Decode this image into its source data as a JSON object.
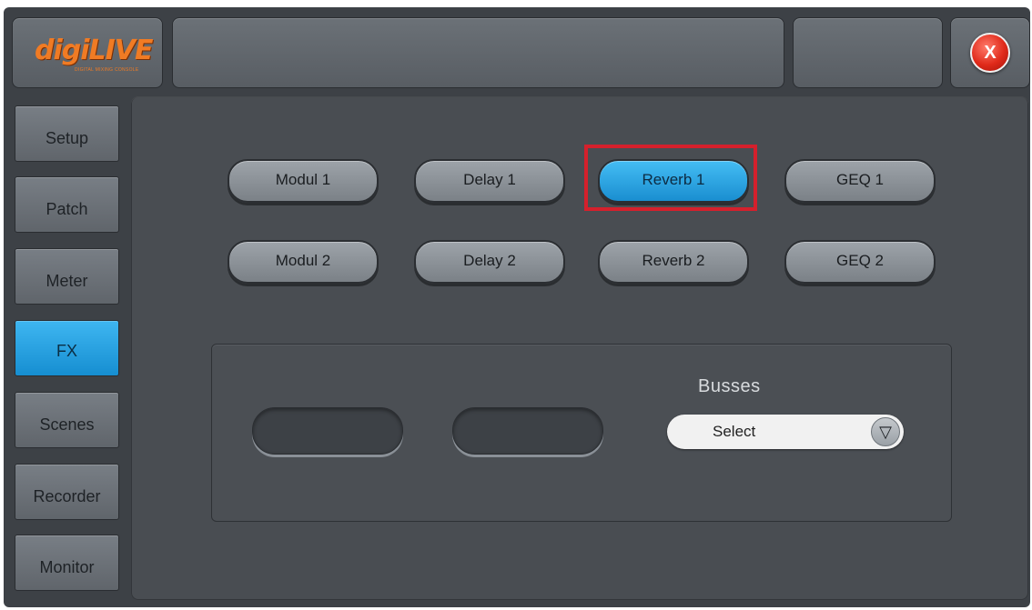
{
  "app": {
    "logo_text": "digiLIVE",
    "logo_subtitle": "DIGITAL MIXING CONSOLE",
    "title_text": ""
  },
  "header": {
    "close_label": "X"
  },
  "sidebar": {
    "items": [
      {
        "label": "Setup"
      },
      {
        "label": "Patch"
      },
      {
        "label": "Meter"
      },
      {
        "label": "FX",
        "active": true
      },
      {
        "label": "Scenes"
      },
      {
        "label": "Recorder"
      },
      {
        "label": "Monitor"
      }
    ]
  },
  "fx": {
    "buttons": [
      {
        "label": "Modul 1"
      },
      {
        "label": "Delay 1"
      },
      {
        "label": "Reverb 1",
        "selected": true
      },
      {
        "label": "GEQ 1"
      },
      {
        "label": "Modul 2"
      },
      {
        "label": "Delay 2"
      },
      {
        "label": "Reverb 2"
      },
      {
        "label": "GEQ 2"
      }
    ]
  },
  "busses": {
    "label": "Busses",
    "select_value": "Select"
  },
  "colors": {
    "accent": "#1ea0e2",
    "highlight": "#d5202c",
    "close": "#e02a1a",
    "logo": "#f07b24"
  }
}
